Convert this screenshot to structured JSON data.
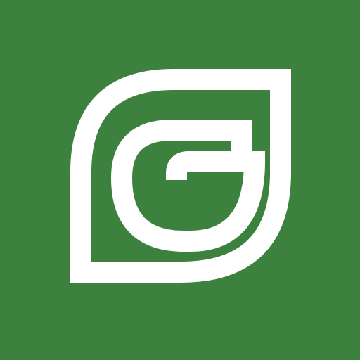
{
  "icon": {
    "name": "leaf-g-logo-icon",
    "background_color": "#3d813e",
    "mark_color": "#ffffff"
  }
}
